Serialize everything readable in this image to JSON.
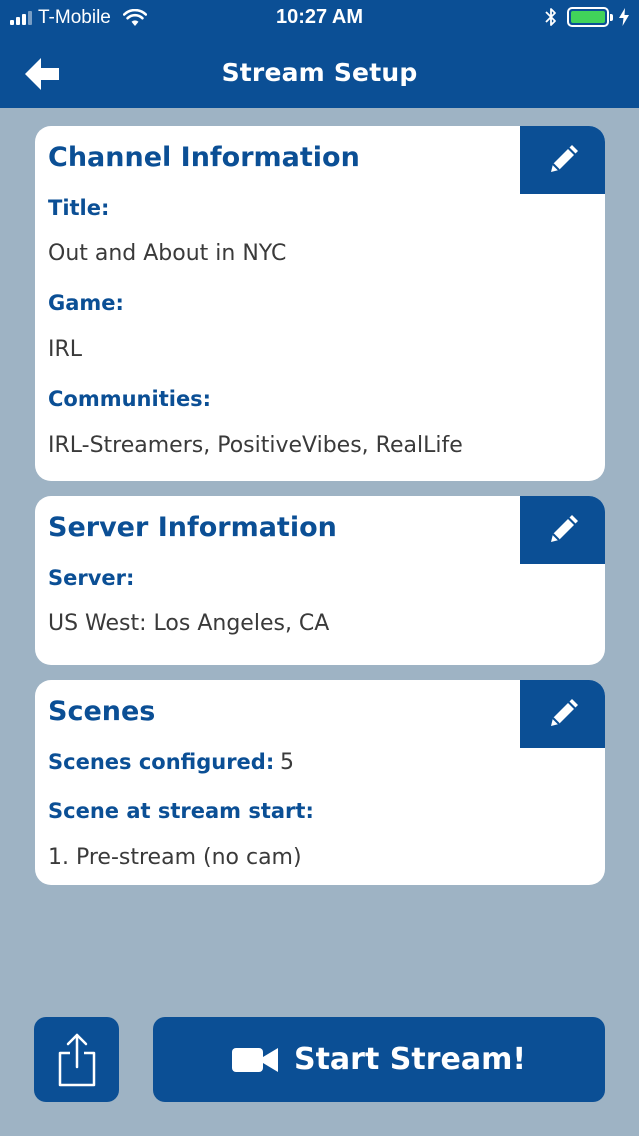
{
  "status_bar": {
    "carrier": "T-Mobile",
    "time": "10:27 AM"
  },
  "header": {
    "title": "Stream Setup"
  },
  "channel": {
    "title": "Channel Information",
    "title_label": "Title:",
    "title_value": "Out and About in NYC",
    "game_label": "Game:",
    "game_value": "IRL",
    "communities_label": "Communities:",
    "communities_value": "IRL-Streamers, PositiveVibes, RealLife"
  },
  "server": {
    "title": "Server Information",
    "server_label": "Server:",
    "server_value": "US West: Los Angeles, CA"
  },
  "scenes": {
    "title": "Scenes",
    "configured_label": "Scenes configured:",
    "configured_value": "5",
    "start_label": "Scene at stream start:",
    "start_value": "1. Pre-stream (no cam)"
  },
  "actions": {
    "start_label": "Start Stream!"
  },
  "icons": {
    "back": "arrow-left-icon",
    "edit": "pencil-icon",
    "share": "share-icon",
    "camera": "video-camera-icon"
  },
  "colors": {
    "primary": "#0b4f95",
    "background": "#9eb3c4",
    "card": "#ffffff",
    "text": "#3a3a3a",
    "battery": "#41d35a"
  }
}
